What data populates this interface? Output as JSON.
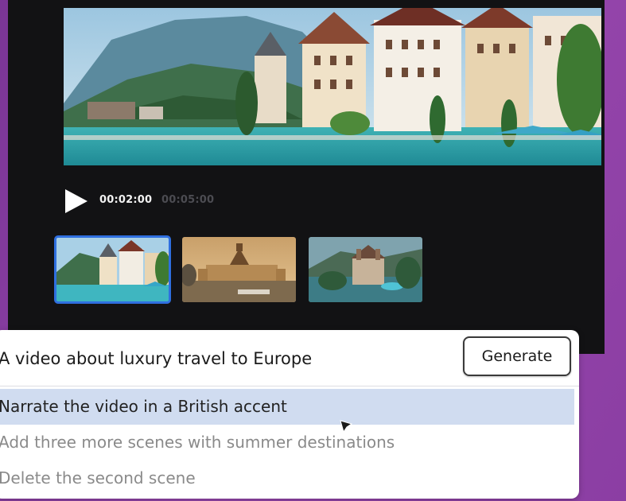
{
  "player": {
    "current_time": "00:02:00",
    "total_time": "00:05:00"
  },
  "scenes": [
    {
      "label": "alpine-lake-village",
      "selected": true
    },
    {
      "label": "budapest-parliament-river",
      "selected": false
    },
    {
      "label": "lakeside-castle",
      "selected": false
    }
  ],
  "prompt": {
    "text": "A video about luxury travel to Europe",
    "generate_label": "Generate"
  },
  "suggestions": [
    {
      "text": "Narrate the video in a British accent",
      "highlighted": true
    },
    {
      "text": "Add three more scenes with summer destinations",
      "highlighted": false
    },
    {
      "text": "Delete the second scene",
      "highlighted": false
    }
  ],
  "colors": {
    "background": "#8a3fa0",
    "player_bg": "#121214",
    "selection": "#2f6fe0",
    "suggestion_highlight": "#d0dcf0"
  },
  "icons": {
    "play": "play-icon",
    "cursor": "mouse-cursor-icon"
  }
}
